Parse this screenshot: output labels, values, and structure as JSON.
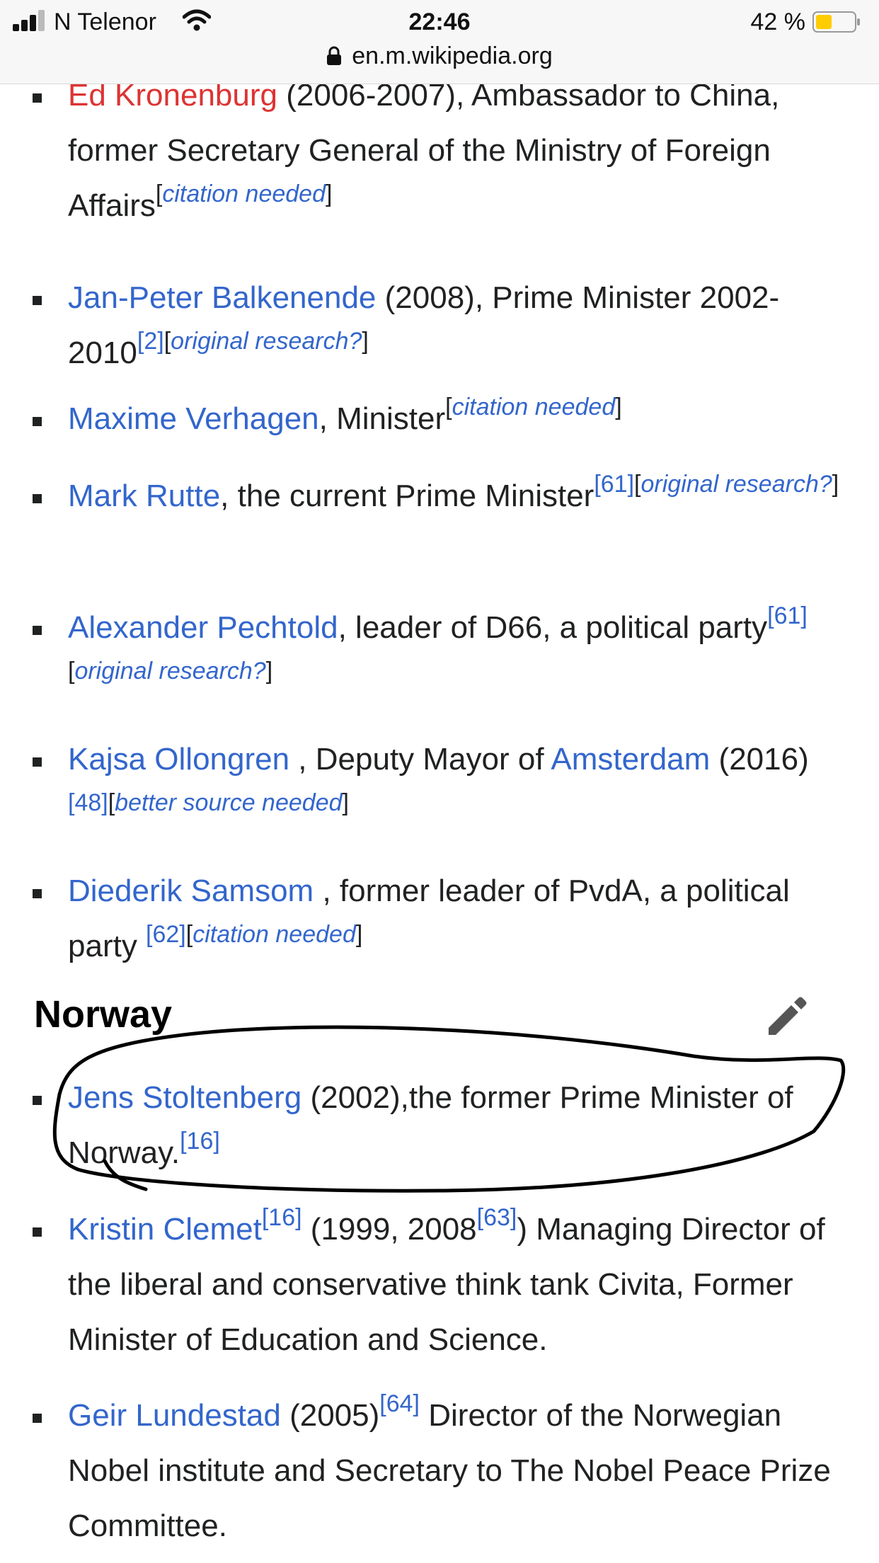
{
  "status_bar": {
    "carrier": "N Telenor",
    "time": "22:46",
    "battery_percent": "42 %",
    "battery_level": 0.42
  },
  "url_bar": {
    "url": "en.m.wikipedia.org"
  },
  "items": [
    {
      "name": "Ed Kronenburg",
      "text": " (2006-2007), Ambassador to China, former Secretary General of the Ministry of Foreign Affairs",
      "tag": "citation needed"
    },
    {
      "name": "Jan-Peter Balkenende",
      "text": " (2008), Prime Minister 2002-2010",
      "ref": "[2]",
      "tag": "original research?"
    },
    {
      "name": "Maxime Verhagen",
      "text": ", Minister",
      "tag": "citation needed"
    },
    {
      "name": "Mark Rutte",
      "text": ", the current Prime Minister",
      "ref": "[61]",
      "tag": "original research?"
    },
    {
      "name": "Alexander Pechtold",
      "text": ", leader of D66, a political party",
      "ref": "[61]",
      "tag": "original research?"
    },
    {
      "name": "Kajsa Ollongren",
      "text": " , Deputy Mayor of ",
      "link2": "Amsterdam",
      "text2": " (2016) ",
      "ref": "[48]",
      "tag": "better source needed"
    },
    {
      "name": "Diederik Samsom",
      "text": " , former leader of PvdA, a political party ",
      "ref": "[62]",
      "tag": "citation needed"
    }
  ],
  "section": {
    "heading": "Norway",
    "edit_icon": "pencil-icon"
  },
  "norway_items": [
    {
      "name": "Jens Stoltenberg",
      "text": " (2002),the former Prime Minister of Norway.",
      "ref": "[16]"
    },
    {
      "name": "Kristin Clemet",
      "ref1": "[16]",
      "text": " (1999, 2008",
      "ref2": "[63]",
      "text2": ") Managing Director of the liberal and conservative think tank Civita, Former Minister of Education and Science."
    },
    {
      "name": "Geir Lundestad",
      "text": " (2005)",
      "ref": "[64]",
      "text2": " Director of the Norwegian Nobel institute and Secretary to The Nobel Peace Prize Committee."
    }
  ]
}
